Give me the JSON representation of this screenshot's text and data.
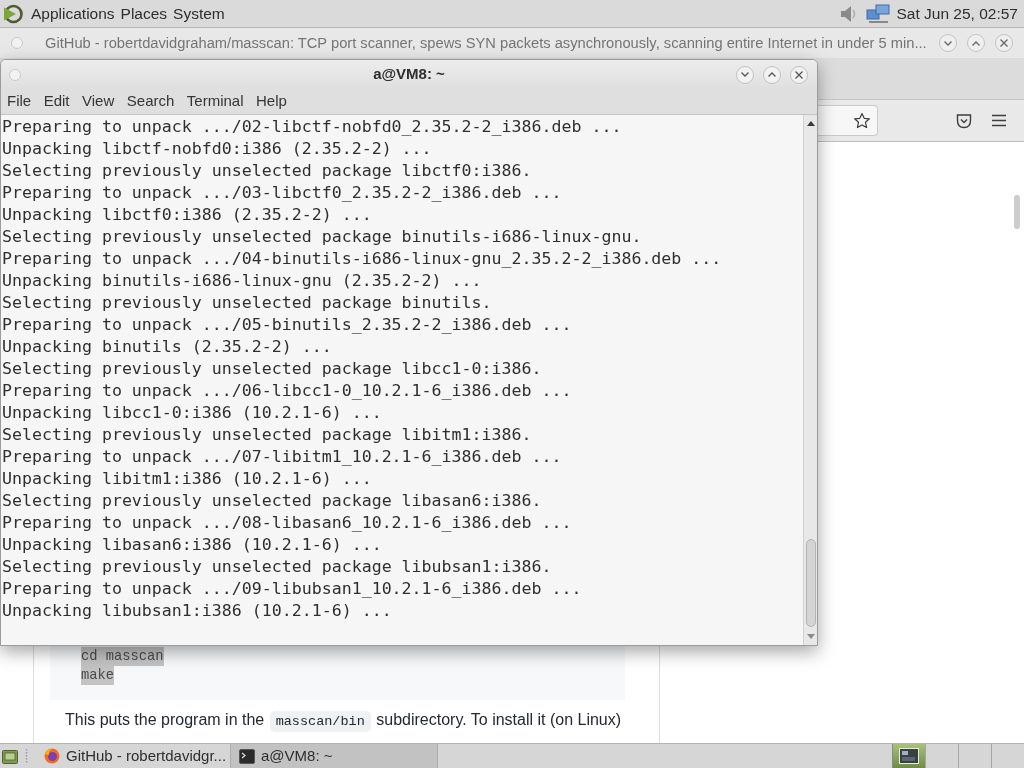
{
  "top_panel": {
    "menus": [
      "Applications",
      "Places",
      "System"
    ],
    "clock": "Sat Jun 25, 02:57"
  },
  "browser": {
    "title": "GitHub - robertdavidgraham/masscan: TCP port scanner, spews SYN packets asynchronously, scanning entire Internet in under 5 min...",
    "code_lines": [
      {
        "text": "cd masscan",
        "selected": true
      },
      {
        "text": "make",
        "selected": true
      }
    ],
    "paragraph": [
      {
        "kind": "text",
        "text": "This puts the program in the "
      },
      {
        "kind": "code",
        "text": "masscan/bin"
      },
      {
        "kind": "text",
        "text": " subdirectory. To install it (on Linux)"
      }
    ]
  },
  "terminal": {
    "title": "a@VM8: ~",
    "menus": [
      "File",
      "Edit",
      "View",
      "Search",
      "Terminal",
      "Help"
    ],
    "lines": [
      "Preparing to unpack .../02-libctf-nobfd0_2.35.2-2_i386.deb ...",
      "Unpacking libctf-nobfd0:i386 (2.35.2-2) ...",
      "Selecting previously unselected package libctf0:i386.",
      "Preparing to unpack .../03-libctf0_2.35.2-2_i386.deb ...",
      "Unpacking libctf0:i386 (2.35.2-2) ...",
      "Selecting previously unselected package binutils-i686-linux-gnu.",
      "Preparing to unpack .../04-binutils-i686-linux-gnu_2.35.2-2_i386.deb ...",
      "Unpacking binutils-i686-linux-gnu (2.35.2-2) ...",
      "Selecting previously unselected package binutils.",
      "Preparing to unpack .../05-binutils_2.35.2-2_i386.deb ...",
      "Unpacking binutils (2.35.2-2) ...",
      "Selecting previously unselected package libcc1-0:i386.",
      "Preparing to unpack .../06-libcc1-0_10.2.1-6_i386.deb ...",
      "Unpacking libcc1-0:i386 (10.2.1-6) ...",
      "Selecting previously unselected package libitm1:i386.",
      "Preparing to unpack .../07-libitm1_10.2.1-6_i386.deb ...",
      "Unpacking libitm1:i386 (10.2.1-6) ...",
      "Selecting previously unselected package libasan6:i386.",
      "Preparing to unpack .../08-libasan6_10.2.1-6_i386.deb ...",
      "Unpacking libasan6:i386 (10.2.1-6) ...",
      "Selecting previously unselected package libubsan1:i386.",
      "Preparing to unpack .../09-libubsan1_10.2.1-6_i386.deb ...",
      "Unpacking libubsan1:i386 (10.2.1-6) ..."
    ]
  },
  "taskbar": {
    "tasks": [
      {
        "kind": "browser",
        "label": "GitHub - robertdavidgr...",
        "selected": false
      },
      {
        "kind": "terminal",
        "label": "a@VM8: ~",
        "selected": true
      }
    ],
    "workspaces": [
      {
        "selected": true
      },
      {
        "selected": false
      },
      {
        "selected": false
      },
      {
        "selected": false
      }
    ]
  }
}
